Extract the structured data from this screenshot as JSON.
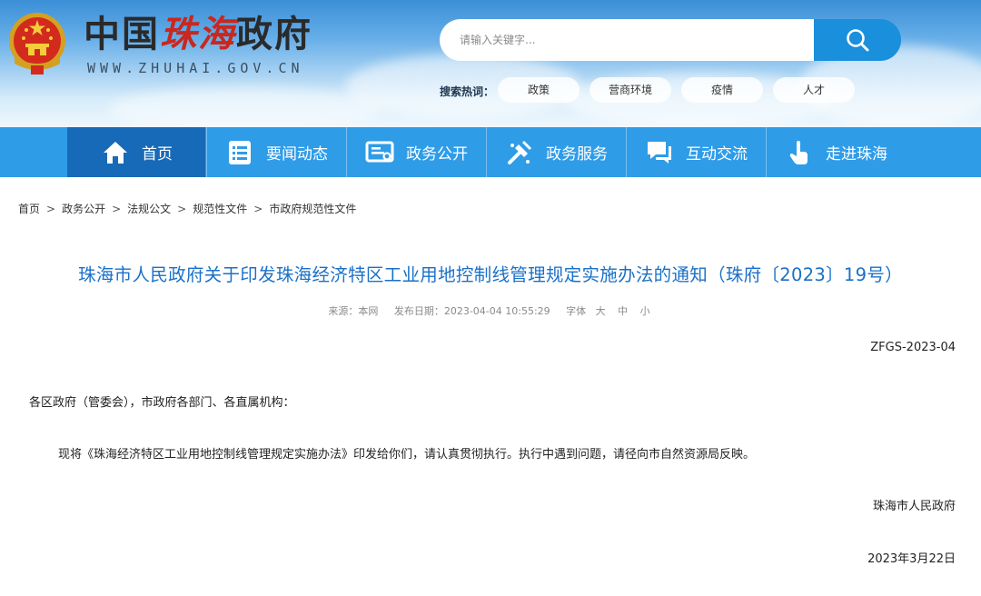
{
  "header": {
    "logo_prefix": "中国",
    "logo_city": "珠海",
    "logo_suffix": "政府",
    "site_url": "WWW.ZHUHAI.GOV.CN",
    "search_placeholder": "请输入关键字...",
    "hot_label": "搜索热词：",
    "hot_words": [
      "政策",
      "营商环境",
      "疫情",
      "人才"
    ]
  },
  "nav": {
    "items": [
      {
        "label": "首页",
        "icon": "home-icon"
      },
      {
        "label": "要闻动态",
        "icon": "news-list-icon"
      },
      {
        "label": "政务公开",
        "icon": "document-icon"
      },
      {
        "label": "政务服务",
        "icon": "tools-icon"
      },
      {
        "label": "互动交流",
        "icon": "chat-icon"
      },
      {
        "label": "走进珠海",
        "icon": "hand-pointer-icon"
      }
    ]
  },
  "breadcrumb": [
    "首页",
    "政务公开",
    "法规公文",
    "规范性文件",
    "市政府规范性文件"
  ],
  "article": {
    "title": "珠海市人民政府关于印发珠海经济特区工业用地控制线管理规定实施办法的通知（珠府〔2023〕19号）",
    "source": "来源：本网",
    "publish_date": "发布日期：2023-04-04 10:55:29",
    "font_label": "字体",
    "font_sizes": [
      "大",
      "中",
      "小"
    ],
    "doc_code": "ZFGS-2023-04",
    "salutation": "各区政府（管委会），市政府各部门、各直属机构：",
    "body": "现将《珠海经济特区工业用地控制线管理规定实施办法》印发给你们，请认真贯彻执行。执行中遇到问题，请径向市自然资源局反映。",
    "signer": "珠海市人民政府",
    "date": "2023年3月22日"
  },
  "colors": {
    "nav_bg": "#2f9ce8",
    "nav_active": "#176ab8",
    "title_blue": "#1a70c8",
    "logo_red": "#c8281e",
    "search_btn": "#1a8fdc"
  }
}
